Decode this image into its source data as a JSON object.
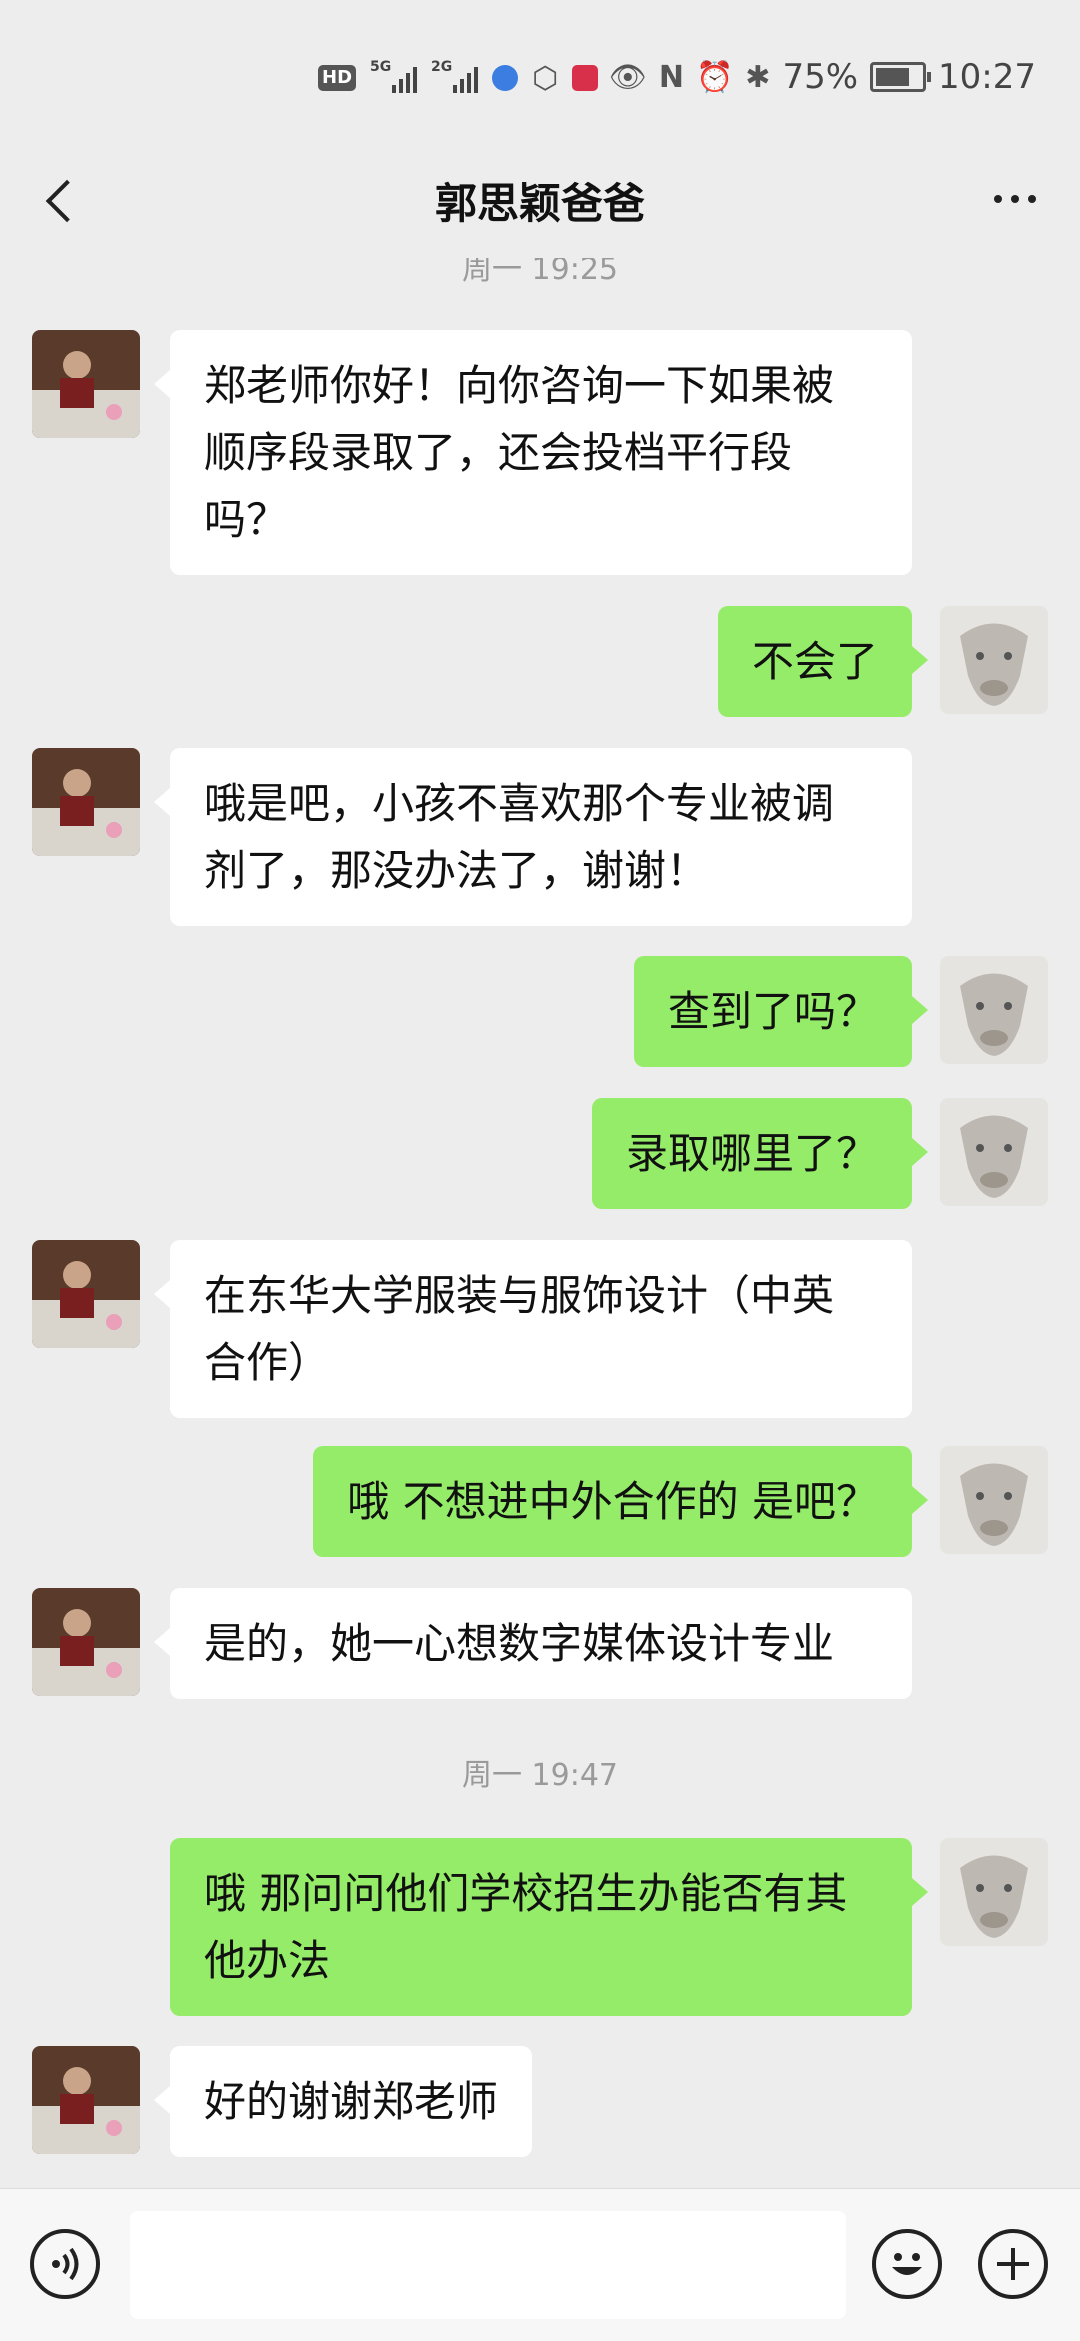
{
  "status_bar": {
    "hd": "HD",
    "net1": "5G",
    "net2": "2G",
    "battery": "75%",
    "battery_level": 0.75,
    "time": "10:27"
  },
  "nav": {
    "title": "郭思颖爸爸"
  },
  "chat": {
    "timestamp_top": "周一 19:25",
    "timestamp_mid": "周一 19:47",
    "messages": [
      {
        "side": "in",
        "text": "郑老师你好！向你咨询一下如果被\n顺序段录取了，还会投档平行段\n吗？"
      },
      {
        "side": "out",
        "text": "不会了"
      },
      {
        "side": "in",
        "text": "哦是吧，小孩不喜欢那个专业被调\n剂了，那没办法了，谢谢！"
      },
      {
        "side": "out",
        "text": "查到了吗？"
      },
      {
        "side": "out",
        "text": "录取哪里了？"
      },
      {
        "side": "in",
        "text": "在东华大学服装与服饰设计（中英\n合作）"
      },
      {
        "side": "out",
        "text": "哦 不想进中外合作的 是吧？"
      },
      {
        "side": "in",
        "text": "是的，她一心想数字媒体设计专业"
      },
      {
        "side": "out",
        "text": "哦 那问问他们学校招生办能否有其\n他办法"
      },
      {
        "side": "in",
        "text": "好的谢谢郑老师"
      }
    ]
  },
  "input_bar": {
    "placeholder": ""
  },
  "colors": {
    "background": "#EDEDED",
    "outgoing_bubble": "#95EC69",
    "incoming_bubble": "#FFFFFF",
    "timestamp": "#9A9A9A"
  },
  "icons": {
    "back": "chevron-left-icon",
    "more": "more-dots-icon",
    "voice": "voice-icon",
    "emoji": "emoji-icon",
    "plus": "plus-icon"
  }
}
